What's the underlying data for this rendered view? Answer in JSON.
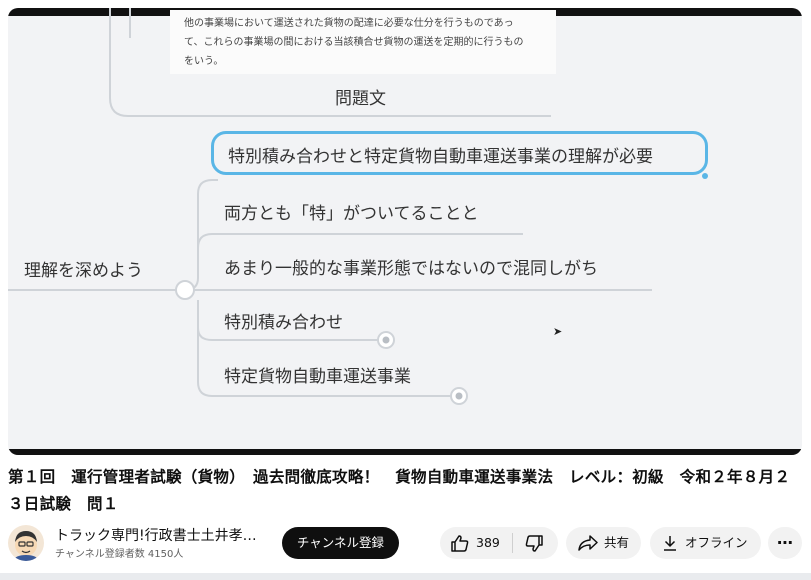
{
  "video": {
    "document_excerpt": [
      "他の事業場において運送された貨物の配達に必要な仕分を行うものであっ",
      "て、これらの事業場の間における当該積合せ貨物の運送を定期的に行うもの",
      "をいう。"
    ],
    "mindmap": {
      "problem_node": "問題文",
      "root": "理解を深めよう",
      "children": [
        "特別積み合わせと特定貨物自動車運送事業の理解が必要",
        "両方とも「特」がついてることと",
        "あまり一般的な事業形態ではないので混同しがち",
        "特別積み合わせ",
        "特定貨物自動車運送事業"
      ]
    }
  },
  "title": "第１回　運行管理者試験（貨物）　過去問徹底攻略！　貨物自動車運送事業法　レベル：初級　令和２年８月２３日試験　問１",
  "channel": {
    "name": "トラック専門!行政書士土井孝…",
    "subscribers": "チャンネル登録者数 4150人",
    "subscribe_label": "チャンネル登録"
  },
  "actions": {
    "like_count": "389",
    "share_label": "共有",
    "offline_label": "オフライン",
    "more_label": "⋯"
  },
  "icons": [
    "thumbs-up-icon",
    "thumbs-down-icon",
    "share-icon",
    "download-icon",
    "more-icon"
  ],
  "colors": {
    "highlight_border": "#5ab6e6",
    "subscribe_bg": "#0f0f0f",
    "pill_bg": "#f2f2f2"
  }
}
